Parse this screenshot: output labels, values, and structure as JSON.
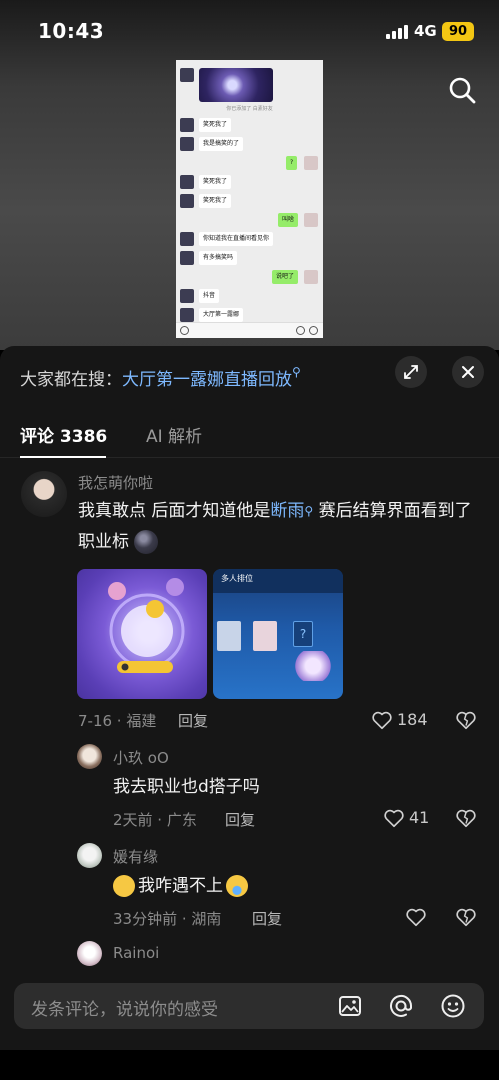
{
  "status_bar": {
    "time": "10:43",
    "network": "4G",
    "battery": "90"
  },
  "video": {
    "thumbnail": {
      "system_text": "你已添加了 白素好友",
      "messages": [
        {
          "side": "left",
          "text": "笑死我了"
        },
        {
          "side": "left",
          "text": "我是搞笑的了"
        },
        {
          "side": "right",
          "text": "?"
        },
        {
          "side": "left",
          "text": "笑死我了"
        },
        {
          "side": "left",
          "text": "笑死我了"
        },
        {
          "side": "right",
          "text": "叫啥"
        },
        {
          "side": "left",
          "text": "你知道我在直播间看见你"
        },
        {
          "side": "left",
          "text": "有多搞笑吗"
        },
        {
          "side": "right",
          "text": "说吧了"
        },
        {
          "side": "left",
          "text": "抖音"
        },
        {
          "side": "left",
          "text": "大厅第一露娜"
        }
      ]
    }
  },
  "panel": {
    "hot_search_prefix": "大家都在搜：",
    "hot_search_keyword": "大厅第一露娜直播回放",
    "tabs": {
      "comments": "评论 3386",
      "ai": "AI 解析"
    },
    "comments": [
      {
        "username": "我怎萌你啦",
        "text_before": "我真敢点 后面才知道他是",
        "link": "断雨",
        "text_after": " 赛后结算界面看到了职业标",
        "meta": "7-16 · 福建",
        "reply": "回复",
        "likes": "184"
      },
      {
        "username": "小玖 oO",
        "text": "我去职业也d搭子吗",
        "meta": "2天前 · 广东",
        "reply": "回复",
        "likes": "41"
      },
      {
        "username": "媛有缘",
        "text": "我咋遇不上",
        "meta": "33分钟前 · 湖南",
        "reply": "回复",
        "likes": ""
      },
      {
        "username": "Rainoi"
      }
    ],
    "image2": {
      "title": "多人排位"
    },
    "composer_placeholder": "发条评论，说说你的感受"
  },
  "colors": {
    "link": "#7eb9ff",
    "battery": "#f3c613",
    "panel_bg": "#161616"
  }
}
